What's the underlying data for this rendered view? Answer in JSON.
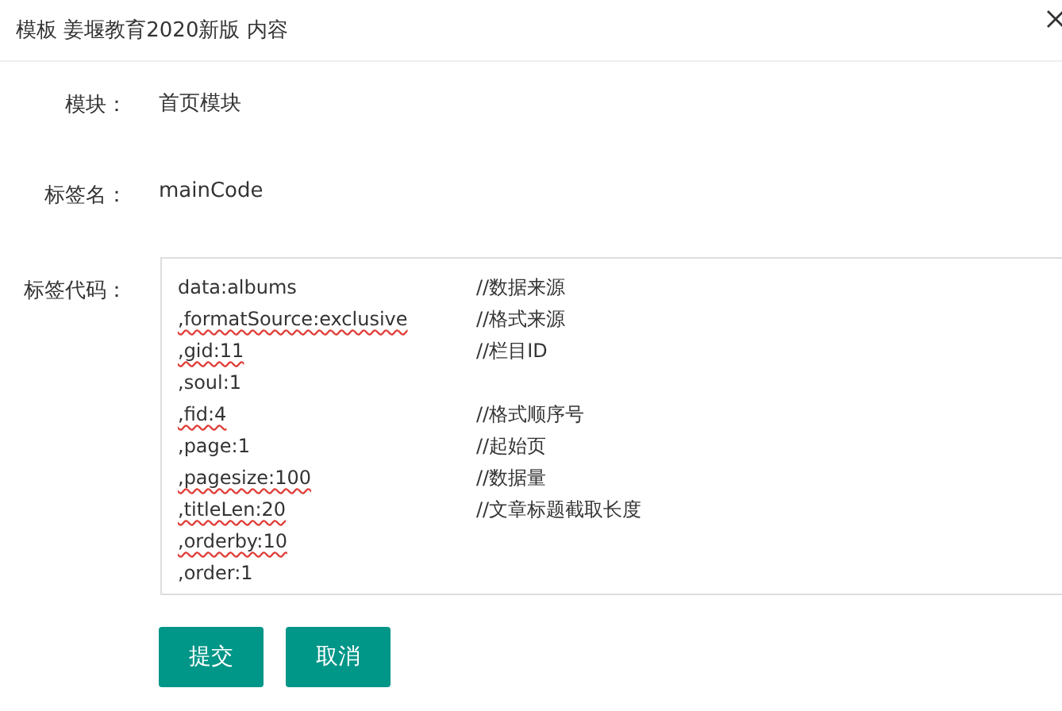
{
  "window": {
    "title": "模板 姜堰教育2020新版 内容"
  },
  "fields": [
    {
      "label": "模块：",
      "value": "首页模块"
    },
    {
      "label": "标签名：",
      "value": "mainCode"
    }
  ],
  "code": {
    "label": "标签代码：",
    "lines": [
      {
        "code": "data:albums",
        "comment": "//数据来源",
        "flagged": false
      },
      {
        "code": ",formatSource:exclusive",
        "comment": "//格式来源",
        "flagged": true
      },
      {
        "code": ",gid:11",
        "comment": "//栏目ID",
        "flagged": true
      },
      {
        "code": ",soul:1",
        "flagged": false
      },
      {
        "code": ",fid:4",
        "comment": "//格式顺序号",
        "flagged": true
      },
      {
        "code": ",page:1",
        "comment": "//起始页",
        "flagged": false
      },
      {
        "code": ",pagesize:100",
        "comment": "//数据量",
        "flagged": true
      },
      {
        "code": ",titleLen:20",
        "comment": "//文章标题截取长度",
        "flagged": true
      },
      {
        "code": ",orderby:10",
        "flagged": true
      },
      {
        "code": ",order:1",
        "flagged": false
      }
    ]
  },
  "buttons": [
    "提交",
    "取消"
  ]
}
